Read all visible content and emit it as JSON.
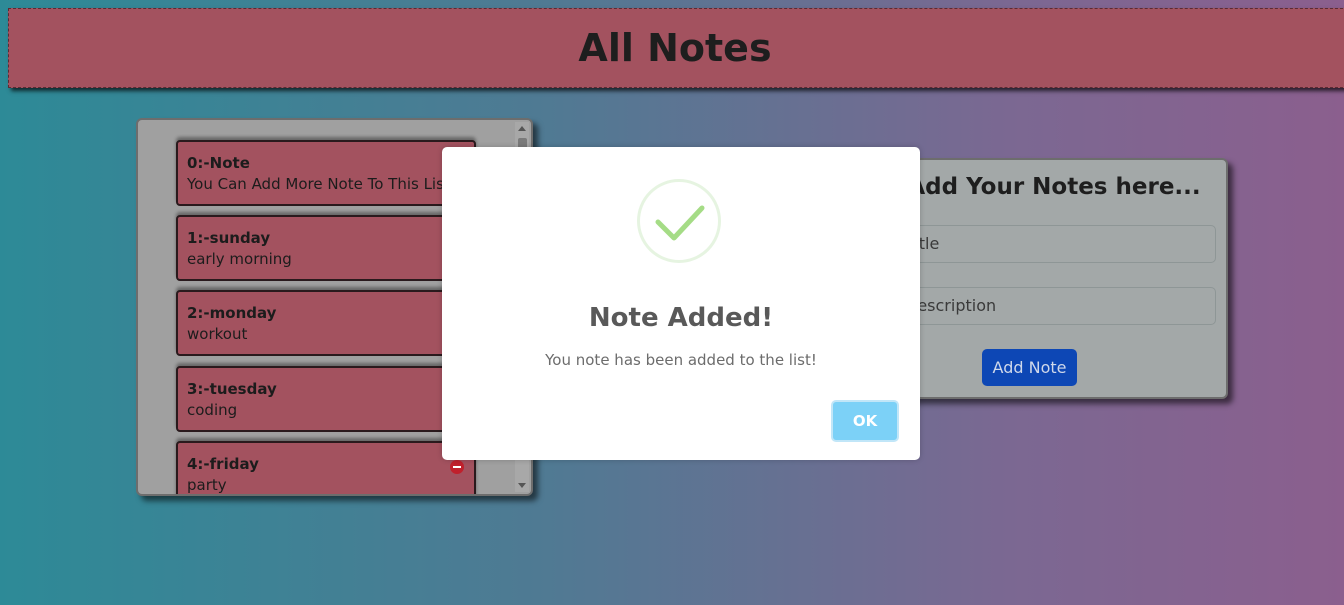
{
  "header": {
    "title": "All Notes"
  },
  "notes": [
    {
      "title": "0:-Note",
      "description": "You Can Add More Note To This List."
    },
    {
      "title": "1:-sunday",
      "description": "early morning"
    },
    {
      "title": "2:-monday",
      "description": "workout"
    },
    {
      "title": "3:-tuesday",
      "description": "coding"
    },
    {
      "title": "4:-friday",
      "description": "party"
    }
  ],
  "add_panel": {
    "heading": "Add Your Notes here...",
    "title_placeholder": "Title",
    "description_placeholder": "Description",
    "button_label": "Add Note"
  },
  "modal": {
    "icon": "checkmark-icon",
    "title": "Note Added!",
    "text": "You note has been added to the list!",
    "ok_label": "OK"
  },
  "colors": {
    "header_bg": "#a3525f",
    "note_bg": "#a3525f",
    "add_button_bg": "#0d47b5",
    "ok_button_bg": "#7cd1f7",
    "check_color": "#a5dc86",
    "delete_icon": "#c0202c"
  }
}
